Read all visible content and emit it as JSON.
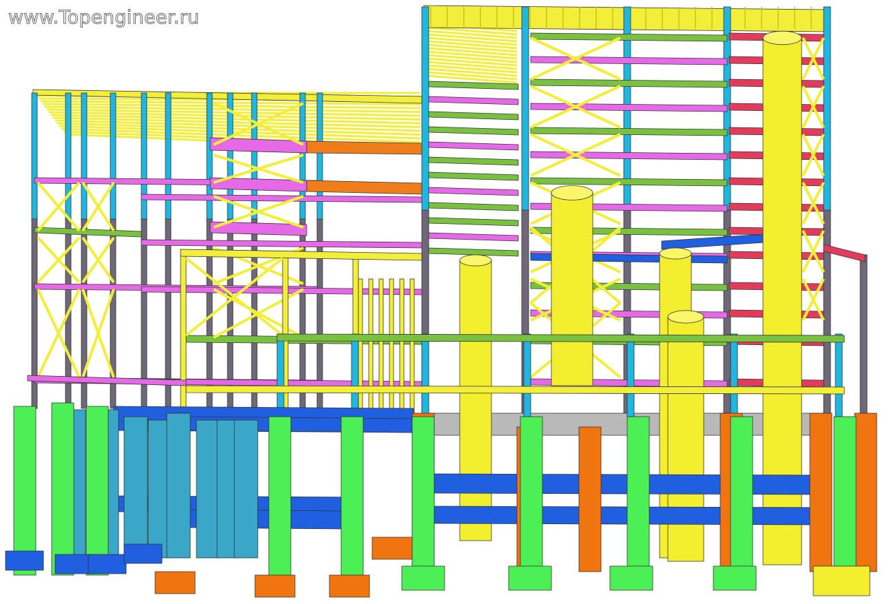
{
  "watermark": {
    "text": "www.Topengineer.ru"
  },
  "palette": {
    "cyan_column": "#1fb6e0",
    "grey_column": "#6e6878",
    "yellow_member": "#f2ee3a",
    "magenta_beam": "#e66ae8",
    "green_beam": "#7ac142",
    "orange_beam": "#f07d1c",
    "red_beam": "#e23b5c",
    "blue_beam": "#1f5fe0",
    "teal_pier": "#3aa7c9",
    "lime_pier": "#4cef56",
    "orange_pier": "#f0740f",
    "yellow_tank": "#f3ef2f",
    "grey_slab": "#b9b9b9"
  }
}
